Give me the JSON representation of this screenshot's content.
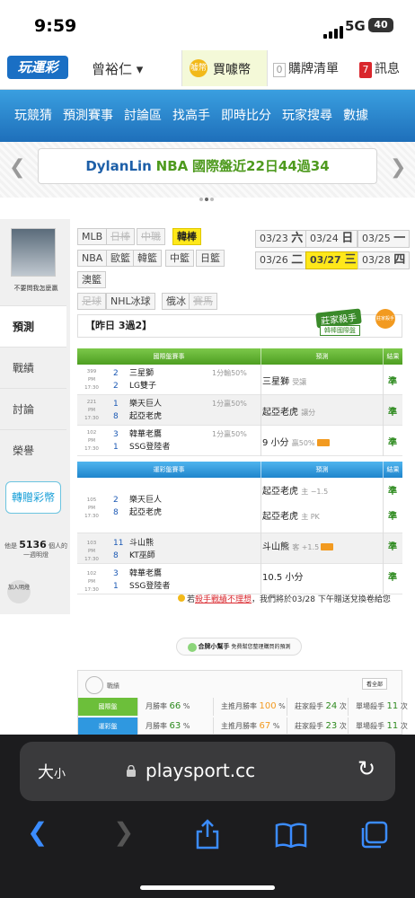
{
  "status": {
    "time": "9:59",
    "network": "5G",
    "battery": "40"
  },
  "header": {
    "logo": "玩運彩",
    "user": "曾裕仁 ▾",
    "coins_label": "買噱幣",
    "coins_badge": "噱幣",
    "cart_count": "0",
    "cart_label": "購牌清單",
    "msg_count": "7",
    "msg_label": "訊息"
  },
  "nav": {
    "items": [
      "玩競猜",
      "預測賽事",
      "討論區",
      "找高手",
      "即時比分",
      "玩家搜尋",
      "數據"
    ]
  },
  "banner": {
    "name": "DylanLin",
    "league": "NBA",
    "stat": "國際盤近22日44過34"
  },
  "sidebar": {
    "avatar_name": "不要問我怎麼贏",
    "tabs": [
      "預測",
      "戰績",
      "討論",
      "榮譽"
    ],
    "gift": "轉贈彩幣",
    "online_prefix": "他是",
    "online_count": "5136",
    "online_suffix": "個人的一週明燈",
    "add_friend": "加入明燈"
  },
  "leagues": {
    "rows": [
      [
        {
          "t": "MLB",
          "s": ""
        },
        {
          "t": "日棒",
          "s": "dis"
        },
        {
          "t": "中職",
          "s": "dis"
        },
        {
          "t": "韓棒",
          "s": "sel"
        }
      ],
      [
        {
          "t": "NBA",
          "s": ""
        },
        {
          "t": "歐籃",
          "s": ""
        },
        {
          "t": "韓籃",
          "s": ""
        },
        {
          "t": "中籃",
          "s": ""
        },
        {
          "t": "日籃",
          "s": ""
        }
      ],
      [
        {
          "t": "澳籃",
          "s": ""
        }
      ],
      [
        {
          "t": "足球",
          "s": "dis"
        },
        {
          "t": "NHL冰球",
          "s": ""
        },
        {
          "t": "俄冰",
          "s": ""
        },
        {
          "t": "賽馬",
          "s": "dis"
        }
      ]
    ]
  },
  "dates": [
    {
      "d": "03/23",
      "w": "六",
      "sel": false
    },
    {
      "d": "03/24",
      "w": "日",
      "sel": false
    },
    {
      "d": "03/25",
      "w": "一",
      "sel": false
    },
    {
      "d": "03/26",
      "w": "二",
      "sel": false
    },
    {
      "d": "03/27",
      "w": "三",
      "sel": true
    },
    {
      "d": "03/28",
      "w": "四",
      "sel": false
    }
  ],
  "yesterday": "【昨日 3過2】",
  "stamp": {
    "main": "莊家殺手",
    "sub": "韓棒國際盤",
    "medal": "莊家殺手"
  },
  "intl": {
    "header": {
      "game": "國際盤賽事",
      "pick": "預測",
      "result": "結果"
    },
    "rows": [
      {
        "no": "399",
        "time": "PM 17:30",
        "n1": "2",
        "n2": "2",
        "t1": "三星獅",
        "t2": "LG雙子",
        "line": "1分輸50%",
        "pick": "三星獅",
        "pick_sub": "受讓",
        "hot": false,
        "res": "準"
      },
      {
        "no": "221",
        "time": "PM 17:30",
        "n1": "1",
        "n2": "8",
        "t1": "樂天巨人",
        "t2": "起亞老虎",
        "line": "1分贏50%",
        "pick": "起亞老虎",
        "pick_sub": "讓分",
        "hot": false,
        "res": "準"
      },
      {
        "no": "102",
        "time": "PM 17:30",
        "n1": "3",
        "n2": "1",
        "t1": "韓華老鷹",
        "t2": "SSG登陸者",
        "line": "1分贏50%",
        "pick": "9 小分",
        "pick_sub": "贏50%",
        "hot": true,
        "res": "準"
      }
    ]
  },
  "local": {
    "header": {
      "game": "運彩盤賽事",
      "pick": "預測",
      "result": "結果"
    },
    "rows": [
      {
        "no": "105",
        "time": "PM 17:30",
        "n1": "2",
        "n2": "8",
        "t1": "樂天巨人",
        "t2": "起亞老虎",
        "picks": [
          {
            "p": "起亞老虎",
            "s": "主 −1.5",
            "hot": false,
            "r": "準"
          },
          {
            "p": "起亞老虎",
            "s": "主 PK",
            "hot": false,
            "r": "準"
          }
        ]
      },
      {
        "no": "103",
        "time": "PM 17:30",
        "n1": "11",
        "n2": "8",
        "t1": "斗山熊",
        "t2": "KT巫師",
        "picks": [
          {
            "p": "斗山熊",
            "s": "客 +1.5",
            "hot": true,
            "r": "準"
          }
        ]
      },
      {
        "no": "102",
        "time": "PM 17:30",
        "n1": "3",
        "n2": "1",
        "t1": "韓華老鷹",
        "t2": "SSG登陸者",
        "picks": [
          {
            "p": "10.5 小分",
            "s": "",
            "hot": false,
            "r": "準"
          }
        ]
      }
    ]
  },
  "note": {
    "pre": "若",
    "link": "殺手戰績不理想",
    "post": "，我們將於03/28 下午贈送兌換卷給您"
  },
  "helper": {
    "name": "合牌小幫手",
    "desc": "免費幫您整理購買的預測"
  },
  "record": {
    "title": "戰績",
    "all": "看全部",
    "rows": [
      {
        "tag": "國際盤",
        "c1": "月勝率 ",
        "v1": "66",
        "u1": " %",
        "c2": "主推月勝率 ",
        "v2": "100",
        "u2": " %",
        "c3": "莊家殺手 ",
        "v3": "24",
        "u3": " 次",
        "c4": "單場殺手 ",
        "v4": "11",
        "u4": " 次"
      },
      {
        "tag": "運彩盤",
        "c1": "月勝率 ",
        "v1": "63",
        "u1": " %",
        "c2": "主推月勝率 ",
        "v2": "67",
        "u2": " %",
        "c3": "莊家殺手 ",
        "v3": "23",
        "u3": " 次",
        "c4": "單場殺手 ",
        "v4": "11",
        "u4": " 次"
      }
    ]
  },
  "safari": {
    "aa": "大",
    "aa_small": "小",
    "url": "playsport.cc"
  },
  "colors": {
    "nav_blue": "#1e6fba",
    "green": "#4d9e21",
    "accent_yellow": "#ffe81a",
    "safari_bg": "#1c1c1e"
  }
}
